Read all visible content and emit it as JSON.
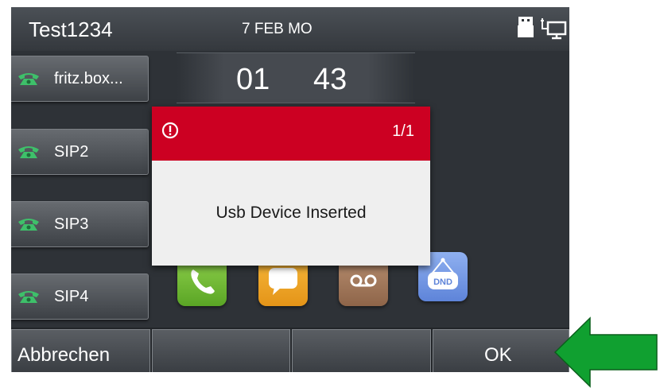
{
  "status_bar": {
    "account": "Test1234",
    "date": "7 FEB MO",
    "icons": [
      "usb-icon",
      "network-icon"
    ]
  },
  "clock": {
    "hour": "01",
    "minute": "43"
  },
  "line_keys": [
    {
      "label": "fritz.box...",
      "icon": "phone-icon"
    },
    {
      "label": "SIP2",
      "icon": "phone-icon"
    },
    {
      "label": "SIP3",
      "icon": "phone-icon"
    },
    {
      "label": "SIP4",
      "icon": "phone-icon"
    }
  ],
  "apps": [
    {
      "name": "phone-app-icon"
    },
    {
      "name": "message-app-icon"
    },
    {
      "name": "voicemail-app-icon"
    },
    {
      "name": "dnd-app-icon",
      "label": "DND"
    }
  ],
  "popup": {
    "counter": "1/1",
    "message": "Usb Device Inserted",
    "icon": "alert-icon"
  },
  "softkeys": [
    "Abbrechen",
    "",
    "",
    "OK"
  ],
  "colors": {
    "popup_header": "#cc0022",
    "arrow": "#10a030",
    "screen_bg": "#2e3237"
  }
}
